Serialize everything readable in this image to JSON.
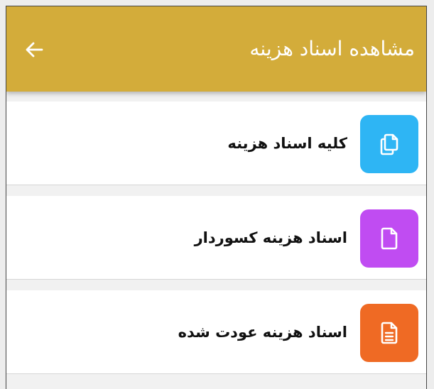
{
  "appbar": {
    "title": "مشاهده اسناد هزینه",
    "background": "#d3ac3a",
    "back_icon": "arrow-left-icon"
  },
  "items": [
    {
      "label": "کلیه اسناد هزینه",
      "icon": "documents-icon",
      "color": "#2eb5f4"
    },
    {
      "label": "اسناد هزینه کسوردار",
      "icon": "document-icon",
      "color": "#c04cf2"
    },
    {
      "label": "اسناد هزینه عودت شده",
      "icon": "document-lines-icon",
      "color": "#ef6a24"
    }
  ]
}
